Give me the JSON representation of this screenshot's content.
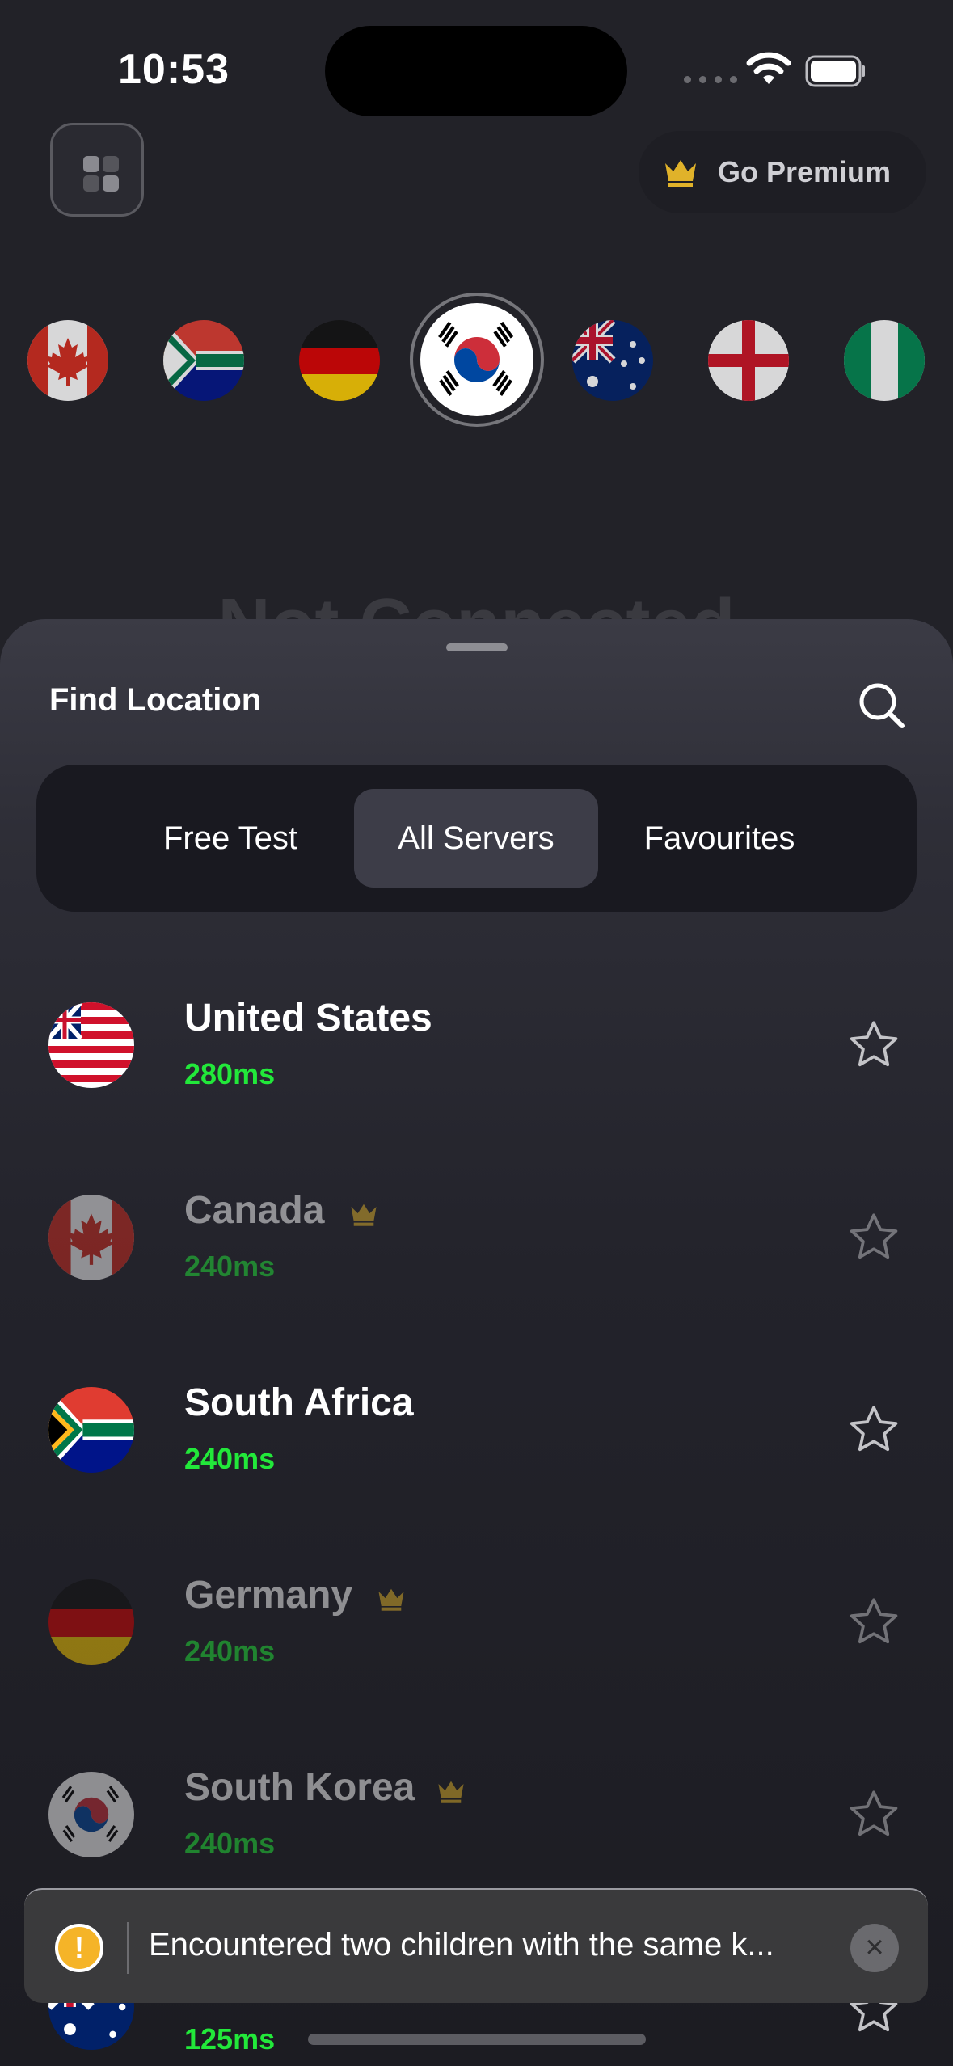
{
  "status_bar": {
    "time": "10:53"
  },
  "header": {
    "premium_label": "Go Premium"
  },
  "background": {
    "status_title": "Not Connected"
  },
  "sheet": {
    "title": "Find Location",
    "tabs": [
      {
        "label": "Free Test",
        "active": false
      },
      {
        "label": "All Servers",
        "active": true
      },
      {
        "label": "Favourites",
        "active": false
      }
    ]
  },
  "servers": [
    {
      "name": "United States",
      "ping": "280ms",
      "premium": false,
      "flag": "liberia-style-flag"
    },
    {
      "name": "Canada",
      "ping": "240ms",
      "premium": true,
      "flag": "canada-flag"
    },
    {
      "name": "South Africa",
      "ping": "240ms",
      "premium": false,
      "flag": "south-africa-flag"
    },
    {
      "name": "Germany",
      "ping": "240ms",
      "premium": true,
      "flag": "germany-flag"
    },
    {
      "name": "South Korea",
      "ping": "240ms",
      "premium": true,
      "flag": "south-korea-flag"
    },
    {
      "name": "",
      "ping": "125ms",
      "premium": false,
      "flag": "australia-flag"
    }
  ],
  "toast": {
    "message": "Encountered two children with the same k..."
  },
  "colors": {
    "accent_green": "#22e83a",
    "premium_gold": "#e0b22a",
    "warning": "#f5b428"
  }
}
